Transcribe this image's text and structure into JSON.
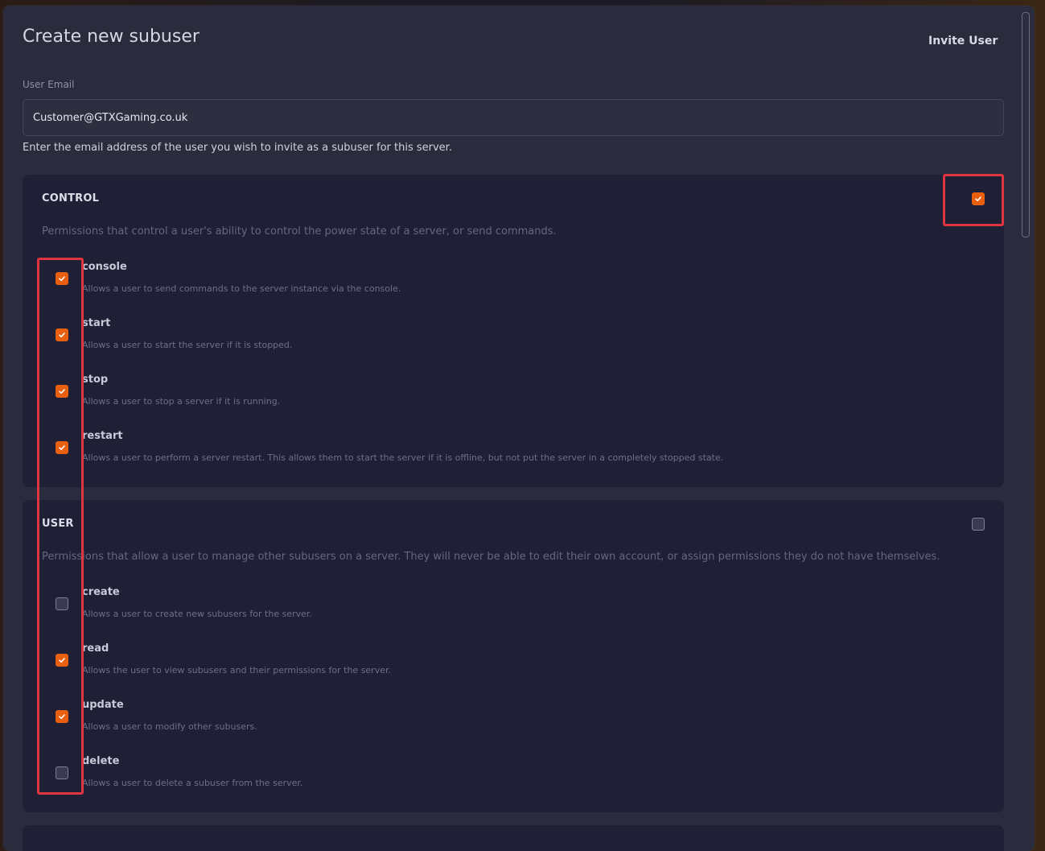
{
  "modal": {
    "title": "Create new subuser",
    "invite_button": "Invite User",
    "email_label": "User Email",
    "email_value": "Customer@GTXGaming.co.uk",
    "email_help": "Enter the email address of the user you wish to invite as a subuser for this server."
  },
  "groups": [
    {
      "title": "CONTROL",
      "description": "Permissions that control a user's ability to control the power state of a server, or send commands.",
      "all_checked": true,
      "permissions": [
        {
          "name": "console",
          "description": "Allows a user to send commands to the server instance via the console.",
          "checked": true
        },
        {
          "name": "start",
          "description": "Allows a user to start the server if it is stopped.",
          "checked": true
        },
        {
          "name": "stop",
          "description": "Allows a user to stop a server if it is running.",
          "checked": true
        },
        {
          "name": "restart",
          "description": "Allows a user to perform a server restart. This allows them to start the server if it is offline, but not put the server in a completely stopped state.",
          "checked": true
        }
      ]
    },
    {
      "title": "USER",
      "description": "Permissions that allow a user to manage other subusers on a server. They will never be able to edit their own account, or assign permissions they do not have themselves.",
      "all_checked": false,
      "permissions": [
        {
          "name": "create",
          "description": "Allows a user to create new subusers for the server.",
          "checked": false
        },
        {
          "name": "read",
          "description": "Allows the user to view subusers and their permissions for the server.",
          "checked": true
        },
        {
          "name": "update",
          "description": "Allows a user to modify other subusers.",
          "checked": true
        },
        {
          "name": "delete",
          "description": "Allows a user to delete a subuser from the server.",
          "checked": false
        }
      ]
    }
  ],
  "colors": {
    "accent": "#e8600f",
    "highlight": "#e0343f"
  }
}
